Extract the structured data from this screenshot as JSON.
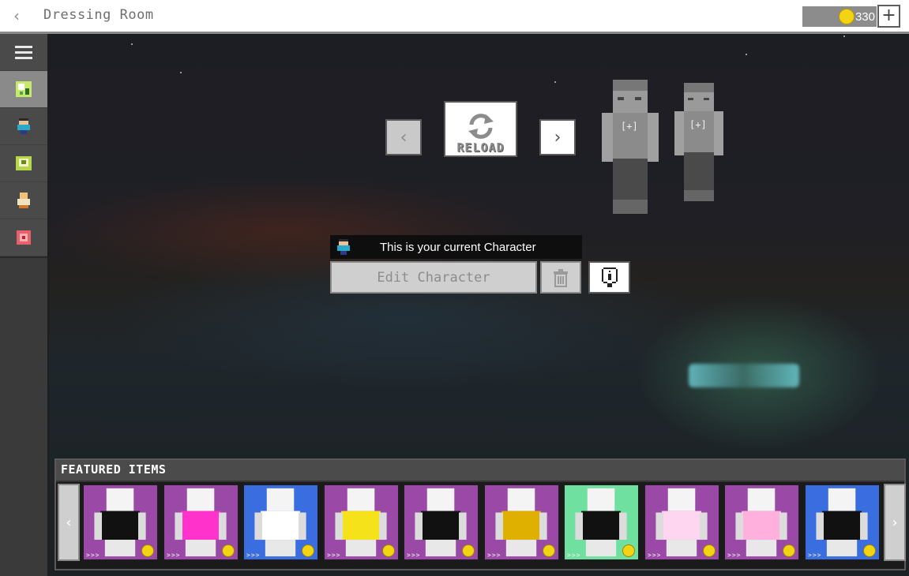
{
  "header": {
    "back_label": "‹",
    "title": "Dressing Room",
    "coins": "330",
    "add_label": "+"
  },
  "sidebar": {
    "items": [
      {
        "name": "menu",
        "icon": "hamburger-icon",
        "active": false
      },
      {
        "name": "dressing-room",
        "icon": "sparkle-character-icon",
        "active": true
      },
      {
        "name": "character",
        "icon": "character-icon",
        "active": false
      },
      {
        "name": "skins",
        "icon": "skin-pack-icon",
        "active": false
      },
      {
        "name": "emotes",
        "icon": "emote-icon",
        "active": false
      },
      {
        "name": "store",
        "icon": "store-icon",
        "active": false
      }
    ]
  },
  "viewer": {
    "prev_label": "‹",
    "next_label": "›",
    "reload_label": "RELOAD",
    "character_plus_label": "[+]"
  },
  "current": {
    "header_text": "This is your current Character",
    "edit_label": "Edit Character"
  },
  "featured": {
    "title": "FEATURED ITEMS",
    "prev_label": "‹",
    "next_label": "›",
    "item_mark": ">>>",
    "items": [
      {
        "name": "dark-tentacle-skin",
        "bg": "#9a4aa6",
        "accent": "#111111"
      },
      {
        "name": "heart-robot-skin",
        "bg": "#9a4aa6",
        "accent": "#ff33cc"
      },
      {
        "name": "duck-skin",
        "bg": "#3a6de0",
        "accent": "#ffffff"
      },
      {
        "name": "gold-armor-skin",
        "bg": "#9a4aa6",
        "accent": "#f5e21a"
      },
      {
        "name": "shadow-creature-skin",
        "bg": "#9a4aa6",
        "accent": "#111111"
      },
      {
        "name": "winged-shadow-skin",
        "bg": "#9a4aa6",
        "accent": "#e0b000"
      },
      {
        "name": "suit-skin",
        "bg": "#6fe0a0",
        "accent": "#111111"
      },
      {
        "name": "pink-dress-skin",
        "bg": "#9a4aa6",
        "accent": "#ffd6ef"
      },
      {
        "name": "pink-heart-skin",
        "bg": "#9a4aa6",
        "accent": "#ffb0dd"
      },
      {
        "name": "mask-skin",
        "bg": "#3a6de0",
        "accent": "#111111"
      }
    ]
  },
  "colors": {
    "coin": "#f3d414",
    "sidebar_bg": "#3a3a3a",
    "accent_active": "#8a8a8a"
  }
}
